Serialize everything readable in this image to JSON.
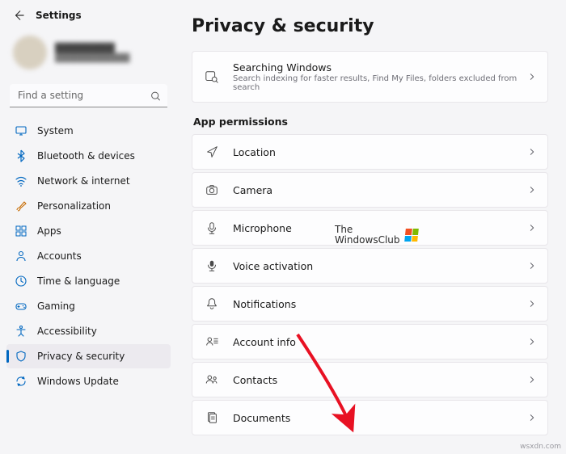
{
  "header": {
    "title": "Settings"
  },
  "user": {
    "name": "████████",
    "email": "████████████"
  },
  "search": {
    "placeholder": "Find a setting"
  },
  "nav": [
    {
      "label": "System",
      "icon": "system",
      "active": false
    },
    {
      "label": "Bluetooth & devices",
      "icon": "bluetooth",
      "active": false
    },
    {
      "label": "Network & internet",
      "icon": "wifi",
      "active": false
    },
    {
      "label": "Personalization",
      "icon": "brush",
      "active": false
    },
    {
      "label": "Apps",
      "icon": "apps",
      "active": false
    },
    {
      "label": "Accounts",
      "icon": "person",
      "active": false
    },
    {
      "label": "Time & language",
      "icon": "clock",
      "active": false
    },
    {
      "label": "Gaming",
      "icon": "gamepad",
      "active": false
    },
    {
      "label": "Accessibility",
      "icon": "accessibility",
      "active": false
    },
    {
      "label": "Privacy & security",
      "icon": "shield",
      "active": true
    },
    {
      "label": "Windows Update",
      "icon": "update",
      "active": false
    }
  ],
  "page": {
    "title": "Privacy & security"
  },
  "topCard": {
    "title": "Searching Windows",
    "sub": "Search indexing for faster results, Find My Files, folders excluded from search"
  },
  "sectionHeader": "App permissions",
  "perms": [
    {
      "label": "Location",
      "icon": "location"
    },
    {
      "label": "Camera",
      "icon": "camera"
    },
    {
      "label": "Microphone",
      "icon": "mic"
    },
    {
      "label": "Voice activation",
      "icon": "voice"
    },
    {
      "label": "Notifications",
      "icon": "bell"
    },
    {
      "label": "Account info",
      "icon": "accountinfo"
    },
    {
      "label": "Contacts",
      "icon": "contacts"
    },
    {
      "label": "Documents",
      "icon": "documents"
    }
  ],
  "brand": {
    "line1": "The",
    "line2": "WindowsClub"
  },
  "watermark": "wsxdn.com"
}
